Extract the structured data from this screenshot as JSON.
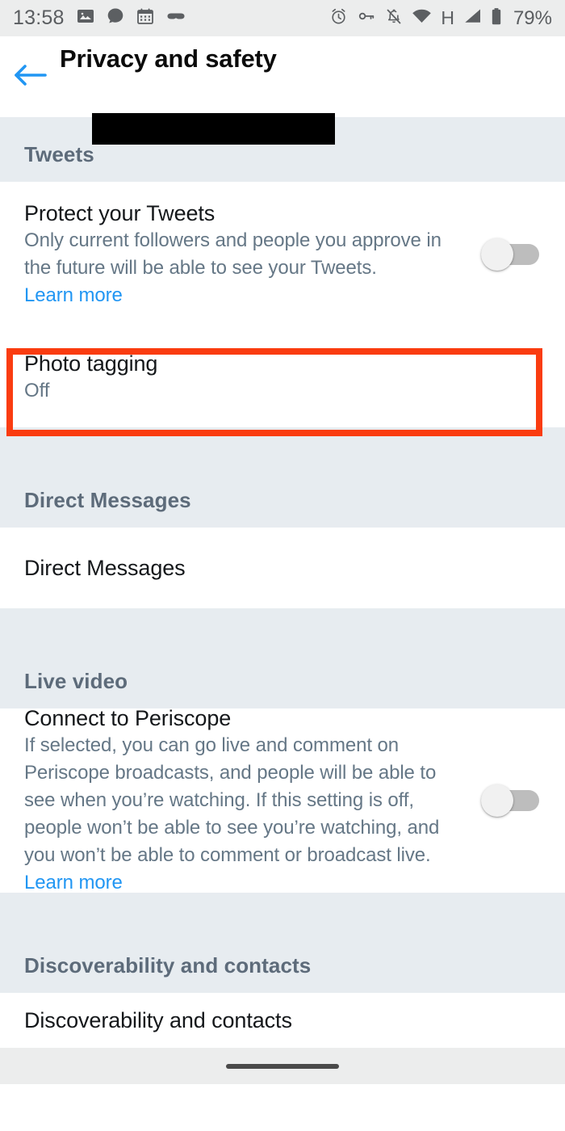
{
  "status_bar": {
    "time": "13:58",
    "battery_percent": "79%",
    "network_type": "H",
    "left_icons": [
      "photo-icon",
      "signal-messenger-icon",
      "calendar-icon",
      "mask-icon"
    ],
    "right_icons": [
      "alarm-icon",
      "vpn-key-icon",
      "notifications-muted-icon",
      "wifi-icon",
      "network-h-icon",
      "cell-signal-icon",
      "battery-icon"
    ]
  },
  "app_bar": {
    "back_icon": "arrow-left-icon",
    "title": "Privacy and safety",
    "subtitle_redacted": true
  },
  "sections": [
    {
      "header": "Tweets",
      "rows": [
        {
          "title": "Protect your Tweets",
          "subtitle": "Only current followers and people you approve in the future will be able to see your Tweets.",
          "link": "Learn more",
          "toggle": "off"
        },
        {
          "title": "Photo tagging",
          "subtitle": "Off",
          "highlighted": true
        }
      ]
    },
    {
      "header": "Direct Messages",
      "rows": [
        {
          "title": "Direct Messages"
        }
      ]
    },
    {
      "header": "Live video",
      "rows": [
        {
          "title": "Connect to Periscope",
          "subtitle": "If selected, you can go live and comment on Periscope broadcasts, and people will be able to see when you’re watching. If this setting is off, people won’t be able to see you’re watching, and you won’t be able to comment or broadcast live.",
          "link": "Learn more",
          "toggle": "off"
        }
      ]
    },
    {
      "header": "Discoverability and contacts",
      "rows": [
        {
          "title": "Discoverability and contacts"
        }
      ]
    }
  ],
  "annotation": {
    "color": "#fa3c10",
    "target": "Photo tagging"
  },
  "colors": {
    "accent_blue": "#2196f3",
    "section_header_bg": "#e7ecf0",
    "section_header_text": "#5d6b7a",
    "primary_text": "#14171a",
    "secondary_text": "#657786",
    "status_bar_bg": "#eceded"
  }
}
